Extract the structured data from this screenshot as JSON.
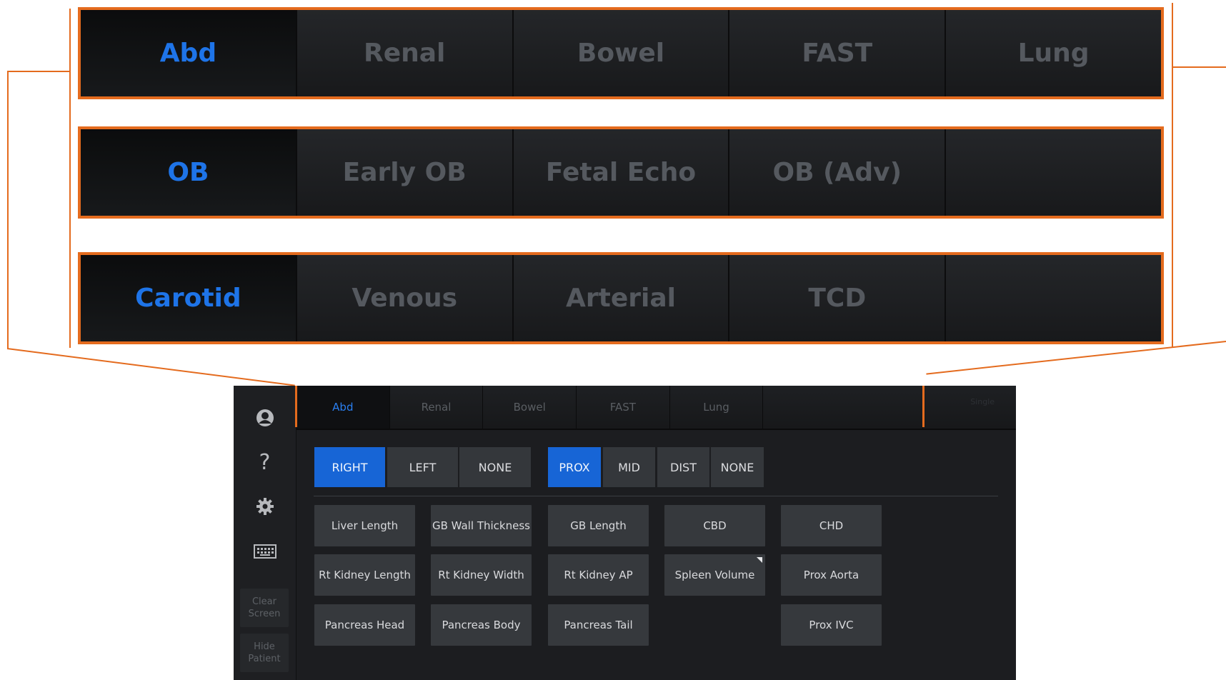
{
  "colors": {
    "accent": "#1e74e8",
    "highlight": "#e46b1e",
    "inactive_text": "#55595f",
    "button_bg": "#34373b"
  },
  "zoom": {
    "row1": [
      "Abd",
      "Renal",
      "Bowel",
      "FAST",
      "Lung"
    ],
    "row2": [
      "OB",
      "Early OB",
      "Fetal Echo",
      "OB (Adv)",
      ""
    ],
    "row3": [
      "Carotid",
      "Venous",
      "Arterial",
      "TCD",
      ""
    ]
  },
  "rail": {
    "icons": [
      "user-icon",
      "help-icon",
      "gear-icon",
      "keyboard-icon"
    ],
    "help_glyph": "?",
    "clear_screen": "Clear\nScreen",
    "hide_patient": "Hide\nPatient"
  },
  "tabs": {
    "items": [
      "Abd",
      "Renal",
      "Bowel",
      "FAST",
      "Lung"
    ],
    "active": "Abd",
    "ghost": "Single"
  },
  "side": {
    "options": [
      "RIGHT",
      "LEFT",
      "NONE"
    ],
    "selected": "RIGHT"
  },
  "position": {
    "options": [
      "PROX",
      "MID",
      "DIST",
      "NONE"
    ],
    "selected": "PROX"
  },
  "measurements": {
    "row1": [
      "Liver Length",
      "GB Wall Thickness",
      "GB Length",
      "CBD",
      "CHD"
    ],
    "row2": [
      "Rt  Kidney Length",
      "Rt  Kidney Width",
      "Rt  Kidney AP",
      "Spleen Volume",
      "Prox Aorta"
    ],
    "row3": [
      "Pancreas Head",
      "Pancreas Body",
      "Pancreas Tail",
      "",
      "Prox IVC"
    ]
  }
}
